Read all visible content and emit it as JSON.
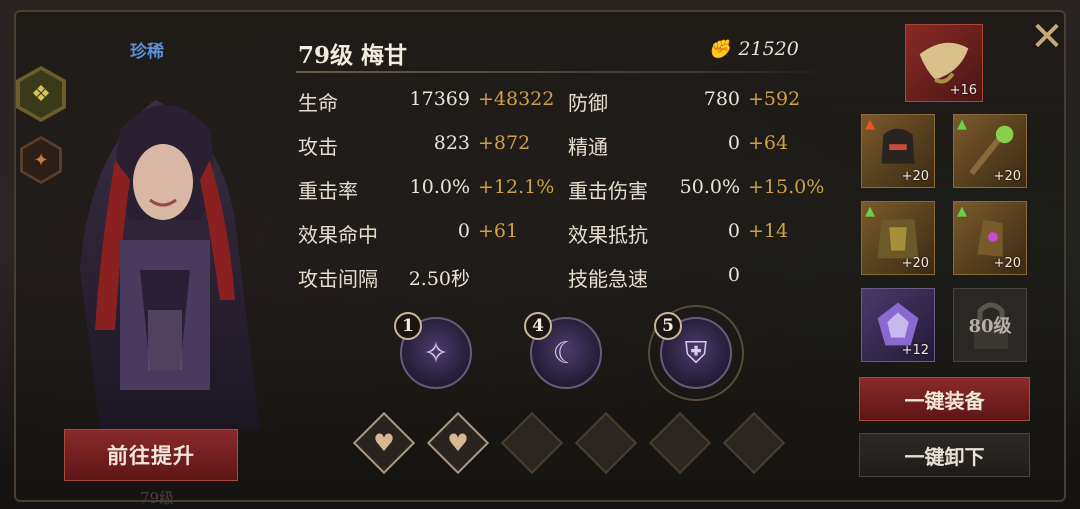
{
  "hero": {
    "rarity": "珍稀",
    "title": "79级 梅甘",
    "power": "21520",
    "upgrade_label": "前往提升",
    "bottom_ghost": "79级"
  },
  "stats": [
    {
      "label": "生命",
      "base": "17369",
      "bonus": "+48322"
    },
    {
      "label": "防御",
      "base": "780",
      "bonus": "+592"
    },
    {
      "label": "攻击",
      "base": "823",
      "bonus": "+872"
    },
    {
      "label": "精通",
      "base": "0",
      "bonus": "+64"
    },
    {
      "label": "重击率",
      "base": "10.0%",
      "bonus": "+12.1%"
    },
    {
      "label": "重击伤害",
      "base": "50.0%",
      "bonus": "+15.0%"
    },
    {
      "label": "效果命中",
      "base": "0",
      "bonus": "+61"
    },
    {
      "label": "效果抵抗",
      "base": "0",
      "bonus": "+14"
    },
    {
      "label": "攻击间隔",
      "base": "2.50秒",
      "bonus": ""
    },
    {
      "label": "技能急速",
      "base": "0",
      "bonus": ""
    }
  ],
  "runes": [
    {
      "num": "1",
      "icon": "star-rune-icon"
    },
    {
      "num": "4",
      "icon": "beast-rune-icon"
    },
    {
      "num": "5",
      "icon": "armor-rune-icon"
    }
  ],
  "gear": {
    "horn_level": "+16",
    "helm_level": "+20",
    "staff_level": "+20",
    "armor_level": "+20",
    "gloves_level": "+20",
    "gem_level": "+12",
    "locked_label": "80级"
  },
  "buttons": {
    "equip_all": "一键装备",
    "unequip_all": "一键卸下"
  },
  "colors": {
    "accent_red": "#7a2020",
    "bonus_gold": "#d0a045",
    "rarity_blue": "#5b8fd6"
  }
}
